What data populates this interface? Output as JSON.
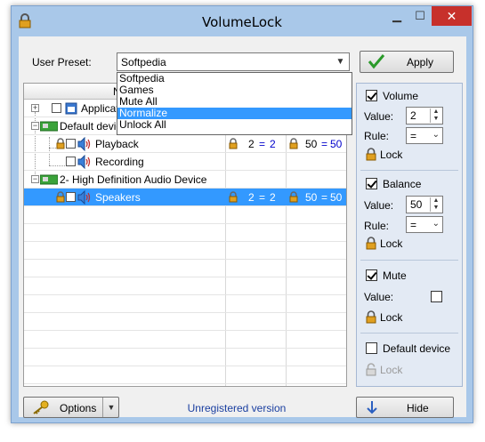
{
  "window": {
    "title": "VolumeLock"
  },
  "preset": {
    "label": "User Preset:",
    "value": "Softpedia",
    "apply_label": "Apply",
    "options": [
      "Softpedia",
      "Games",
      "Mute All",
      "Normalize",
      "Unlock All"
    ],
    "highlighted": "Normalize"
  },
  "list": {
    "header": "N",
    "rows": [
      {
        "name": "Applicati",
        "type": "app"
      },
      {
        "name": "Default devic",
        "type": "group"
      },
      {
        "name": "Playback",
        "vol_l": "2",
        "vol_eq": "=",
        "vol_r": "2",
        "bal_l": "50",
        "bal_eq": "=",
        "bal_r": "50"
      },
      {
        "name": "Recording"
      },
      {
        "name": "2- High Definition Audio Device",
        "type": "group"
      },
      {
        "name": "Speakers",
        "vol_l": "2",
        "vol_eq": "=",
        "vol_r": "2",
        "bal_l": "50",
        "bal_eq": "=",
        "bal_r": "50"
      }
    ]
  },
  "panel": {
    "volume": {
      "label": "Volume",
      "value_label": "Value:",
      "value": "2",
      "rule_label": "Rule:",
      "rule": "=",
      "lock_label": "Lock"
    },
    "balance": {
      "label": "Balance",
      "value_label": "Value:",
      "value": "50",
      "rule_label": "Rule:",
      "rule": "=",
      "lock_label": "Lock"
    },
    "mute": {
      "label": "Mute",
      "value_label": "Value:",
      "lock_label": "Lock"
    },
    "default_device": {
      "label": "Default device",
      "lock_label": "Lock"
    }
  },
  "footer": {
    "options_label": "Options",
    "status": "Unregistered version",
    "hide_label": "Hide"
  }
}
